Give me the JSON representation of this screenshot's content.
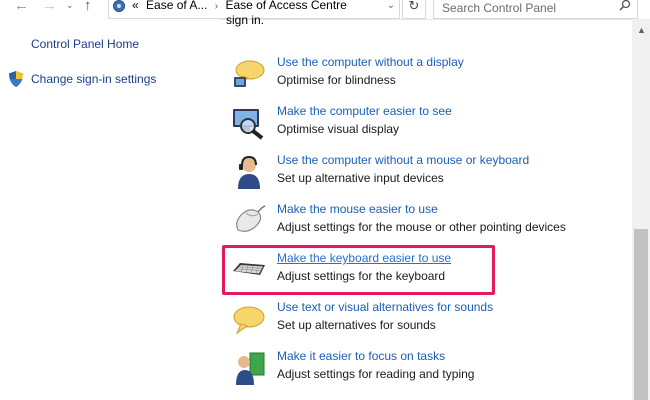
{
  "nav": {
    "back_glyph": "←",
    "forward_glyph": "→",
    "dropdown_glyph": "⌄",
    "up_glyph": "↑"
  },
  "address": {
    "overflow": "«",
    "crumbs": [
      "Ease of A...",
      "Ease of Access Centre"
    ],
    "separator": "›",
    "dropdown_glyph": "⌄"
  },
  "refresh_glyph": "↻",
  "search": {
    "placeholder": "Search Control Panel"
  },
  "left_pane": {
    "home_link": "Control Panel Home",
    "signin_link": "Change sign-in settings"
  },
  "main": {
    "intro_tail": "sign in.",
    "items": [
      {
        "link": "Use the computer without a display",
        "desc": "Optimise for blindness",
        "icon": "speech-bubble-icon"
      },
      {
        "link": "Make the computer easier to see",
        "desc": "Optimise visual display",
        "icon": "magnifier-icon"
      },
      {
        "link": "Use the computer without a mouse or keyboard",
        "desc": "Set up alternative input devices",
        "icon": "headset-user-icon"
      },
      {
        "link": "Make the mouse easier to use",
        "desc": "Adjust settings for the mouse or other pointing devices",
        "icon": "mouse-icon"
      },
      {
        "link": "Make the keyboard easier to use",
        "desc": "Adjust settings for the keyboard",
        "icon": "keyboard-icon"
      },
      {
        "link": "Use text or visual alternatives for sounds",
        "desc": "Set up alternatives for sounds",
        "icon": "speech-bubble-icon"
      },
      {
        "link": "Make it easier to focus on tasks",
        "desc": "Adjust settings for reading and typing",
        "icon": "focus-user-icon"
      }
    ]
  },
  "colors": {
    "link": "#1a5eb8",
    "left_link": "#1a3e8c",
    "highlight": "#e5195f"
  },
  "scroll_up_glyph": "▲"
}
